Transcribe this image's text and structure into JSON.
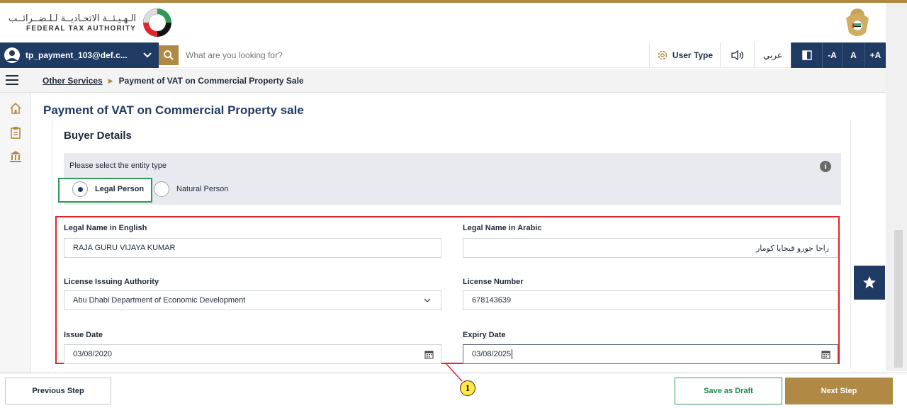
{
  "header": {
    "logo_ar": "الـهـيـئــة الاتحـاديــة لـلـضــرائــب",
    "logo_en": "FEDERAL TAX AUTHORITY"
  },
  "nav": {
    "user_email": "tp_payment_103@def.c...",
    "search_placeholder": "What are you looking for?",
    "user_type_label": "User Type",
    "arabic_label": "عربي",
    "font_decrease": "-A",
    "font_reset": "A",
    "font_increase": "+A"
  },
  "breadcrumb": {
    "parent": "Other Services",
    "current": "Payment of VAT on Commercial Property Sale"
  },
  "page": {
    "title": "Payment of VAT on Commercial Property sale",
    "section_title": "Buyer Details",
    "entity_prompt": "Please select the entity type",
    "entity_options": [
      {
        "label": "Legal Person",
        "selected": true
      },
      {
        "label": "Natural Person",
        "selected": false
      }
    ]
  },
  "form": {
    "legal_name_en_label": "Legal Name in English",
    "legal_name_en_value": "RAJA GURU VIJAYA KUMAR",
    "legal_name_ar_label": "Legal Name in Arabic",
    "legal_name_ar_value": "راجا جورو فيجايا كومار",
    "license_authority_label": "License Issuing Authority",
    "license_authority_value": "Abu Dhabi Department of Economic Development",
    "license_number_label": "License Number",
    "license_number_value": "678143639",
    "issue_date_label": "Issue Date",
    "issue_date_value": "03/08/2020",
    "expiry_date_label": "Expiry Date",
    "expiry_date_value": "03/08/2025"
  },
  "callout": {
    "number": "1"
  },
  "footer": {
    "previous": "Previous Step",
    "draft": "Save as Draft",
    "next": "Next Step"
  },
  "colors": {
    "navy": "#1f3a63",
    "gold": "#b08a45",
    "green": "#2e9a55",
    "red": "#e2242b"
  }
}
